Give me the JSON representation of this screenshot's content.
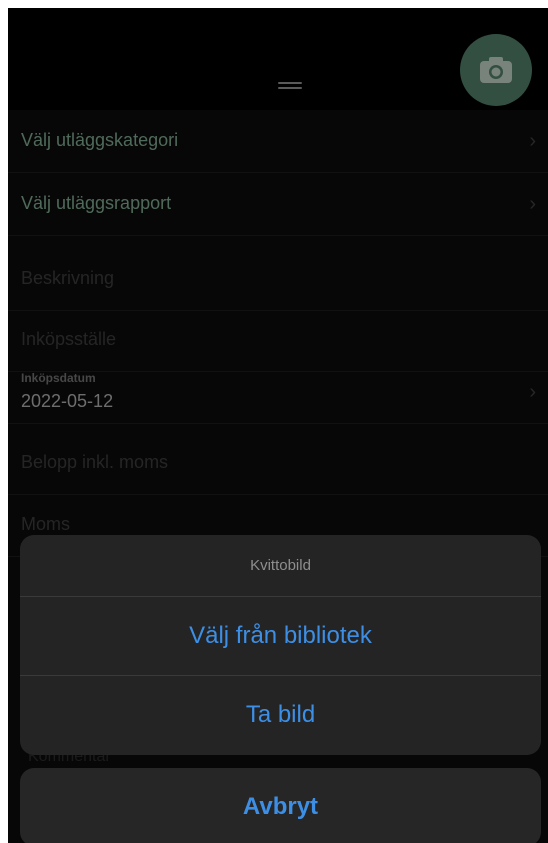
{
  "header": {
    "drag_handle_icon": "drag-handle-icon",
    "camera_icon": "camera-icon"
  },
  "form": {
    "category_label": "Välj utläggskategori",
    "report_label": "Välj utläggsrapport",
    "description_placeholder": "Beskrivning",
    "place_placeholder": "Inköpsställe",
    "date_label": "Inköpsdatum",
    "date_value": "2022-05-12",
    "amount_placeholder": "Belopp inkl. moms",
    "vat_placeholder": "Moms",
    "comment_peek": "Kommentar",
    "chevron": "›"
  },
  "action_sheet": {
    "title": "Kvittobild",
    "choose_from_library": "Välj från bibliotek",
    "take_photo": "Ta bild",
    "cancel": "Avbryt"
  },
  "colors": {
    "accent_green": "#7aa38a",
    "camera_button": "#4f7a66",
    "action_blue": "#3d8fe6"
  }
}
